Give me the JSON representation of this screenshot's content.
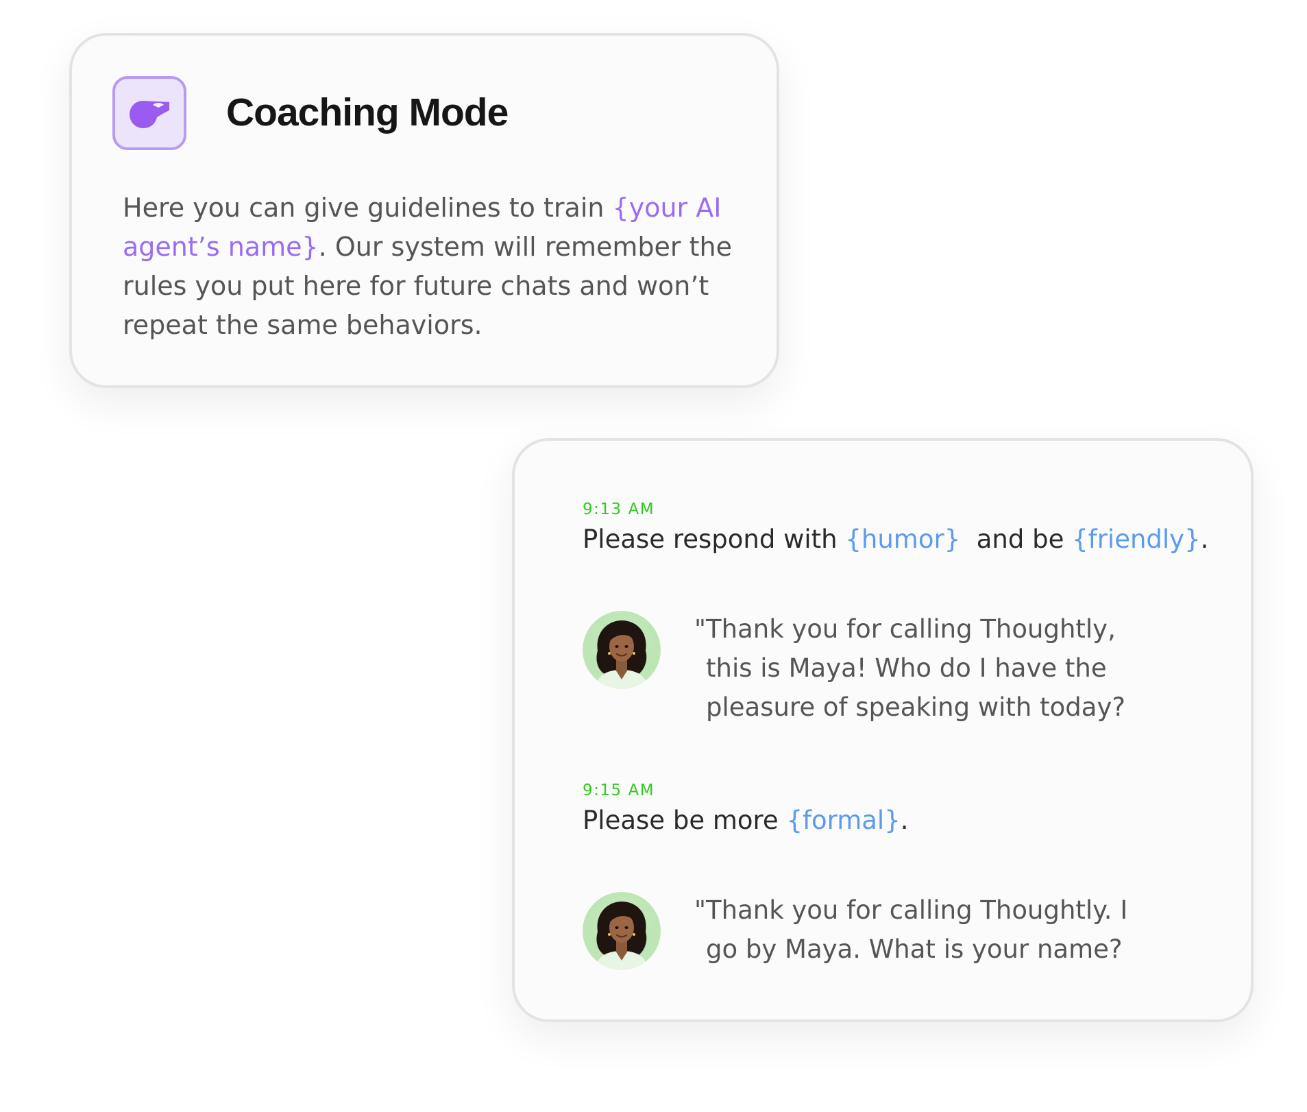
{
  "coaching": {
    "title": "Coaching Mode",
    "icon": "whistle-icon",
    "accent_color": "#9b6cf2",
    "description": {
      "part1": "Here you can give guidelines to train ",
      "variable": "{your AI agent’s name}",
      "part2": ". Our system will remember the rules you put here for future chats and won’t repeat the same behaviors."
    }
  },
  "chat": {
    "timestamp_color": "#2ecc1c",
    "variable_color": "#5a9bf0",
    "messages": [
      {
        "time": "9:13 AM",
        "text_before": "Please respond with ",
        "var1": "{humor}",
        "text_middle": "  and be ",
        "var2": "{friendly}",
        "text_after": "."
      },
      {
        "agent": "Maya",
        "avatar": "agent-avatar",
        "lines": [
          "\"Thank you for calling Thoughtly,",
          "this is Maya! Who do I have the",
          "pleasure of speaking with today?"
        ]
      },
      {
        "time": "9:15 AM",
        "text_before": "Please be more ",
        "var1": "{formal}",
        "text_after": "."
      },
      {
        "agent": "Maya",
        "avatar": "agent-avatar",
        "lines": [
          "\"Thank you for calling Thoughtly. I",
          "go by Maya. What is your name?"
        ]
      }
    ]
  }
}
